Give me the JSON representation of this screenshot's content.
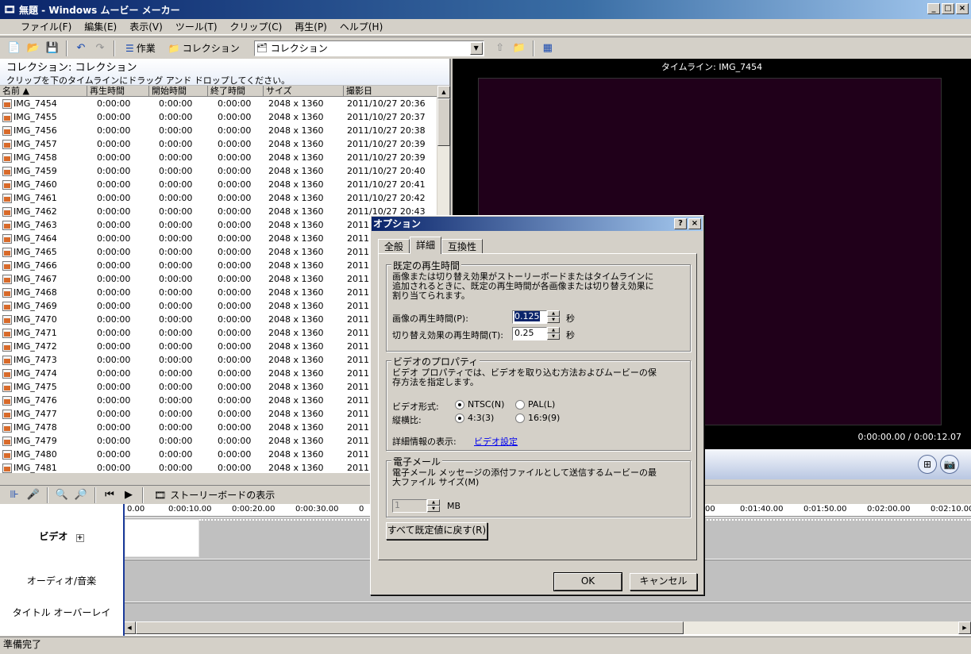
{
  "window": {
    "title": "無題 - Windows ムービー メーカー"
  },
  "menu": [
    "ファイル(F)",
    "編集(E)",
    "表示(V)",
    "ツール(T)",
    "クリップ(C)",
    "再生(P)",
    "ヘルプ(H)"
  ],
  "toolbar": {
    "tasks_label": "作業",
    "collections_label": "コレクション",
    "collection_combo": "コレクション"
  },
  "collection": {
    "title": "コレクション: コレクション",
    "instruction": "クリップを下のタイムラインにドラッグ アンド ドロップしてください。",
    "columns": [
      "名前",
      "再生時間",
      "開始時間",
      "終了時間",
      "サイズ",
      "撮影日"
    ],
    "rows": [
      [
        "IMG_7454",
        "0:00:00",
        "0:00:00",
        "0:00:00",
        "2048 x 1360",
        "2011/10/27 20:36"
      ],
      [
        "IMG_7455",
        "0:00:00",
        "0:00:00",
        "0:00:00",
        "2048 x 1360",
        "2011/10/27 20:37"
      ],
      [
        "IMG_7456",
        "0:00:00",
        "0:00:00",
        "0:00:00",
        "2048 x 1360",
        "2011/10/27 20:38"
      ],
      [
        "IMG_7457",
        "0:00:00",
        "0:00:00",
        "0:00:00",
        "2048 x 1360",
        "2011/10/27 20:39"
      ],
      [
        "IMG_7458",
        "0:00:00",
        "0:00:00",
        "0:00:00",
        "2048 x 1360",
        "2011/10/27 20:39"
      ],
      [
        "IMG_7459",
        "0:00:00",
        "0:00:00",
        "0:00:00",
        "2048 x 1360",
        "2011/10/27 20:40"
      ],
      [
        "IMG_7460",
        "0:00:00",
        "0:00:00",
        "0:00:00",
        "2048 x 1360",
        "2011/10/27 20:41"
      ],
      [
        "IMG_7461",
        "0:00:00",
        "0:00:00",
        "0:00:00",
        "2048 x 1360",
        "2011/10/27 20:42"
      ],
      [
        "IMG_7462",
        "0:00:00",
        "0:00:00",
        "0:00:00",
        "2048 x 1360",
        "2011/10/27 20:43"
      ],
      [
        "IMG_7463",
        "0:00:00",
        "0:00:00",
        "0:00:00",
        "2048 x 1360",
        "2011"
      ],
      [
        "IMG_7464",
        "0:00:00",
        "0:00:00",
        "0:00:00",
        "2048 x 1360",
        "2011"
      ],
      [
        "IMG_7465",
        "0:00:00",
        "0:00:00",
        "0:00:00",
        "2048 x 1360",
        "2011"
      ],
      [
        "IMG_7466",
        "0:00:00",
        "0:00:00",
        "0:00:00",
        "2048 x 1360",
        "2011"
      ],
      [
        "IMG_7467",
        "0:00:00",
        "0:00:00",
        "0:00:00",
        "2048 x 1360",
        "2011"
      ],
      [
        "IMG_7468",
        "0:00:00",
        "0:00:00",
        "0:00:00",
        "2048 x 1360",
        "2011"
      ],
      [
        "IMG_7469",
        "0:00:00",
        "0:00:00",
        "0:00:00",
        "2048 x 1360",
        "2011"
      ],
      [
        "IMG_7470",
        "0:00:00",
        "0:00:00",
        "0:00:00",
        "2048 x 1360",
        "2011"
      ],
      [
        "IMG_7471",
        "0:00:00",
        "0:00:00",
        "0:00:00",
        "2048 x 1360",
        "2011"
      ],
      [
        "IMG_7472",
        "0:00:00",
        "0:00:00",
        "0:00:00",
        "2048 x 1360",
        "2011"
      ],
      [
        "IMG_7473",
        "0:00:00",
        "0:00:00",
        "0:00:00",
        "2048 x 1360",
        "2011"
      ],
      [
        "IMG_7474",
        "0:00:00",
        "0:00:00",
        "0:00:00",
        "2048 x 1360",
        "2011"
      ],
      [
        "IMG_7475",
        "0:00:00",
        "0:00:00",
        "0:00:00",
        "2048 x 1360",
        "2011"
      ],
      [
        "IMG_7476",
        "0:00:00",
        "0:00:00",
        "0:00:00",
        "2048 x 1360",
        "2011"
      ],
      [
        "IMG_7477",
        "0:00:00",
        "0:00:00",
        "0:00:00",
        "2048 x 1360",
        "2011"
      ],
      [
        "IMG_7478",
        "0:00:00",
        "0:00:00",
        "0:00:00",
        "2048 x 1360",
        "2011"
      ],
      [
        "IMG_7479",
        "0:00:00",
        "0:00:00",
        "0:00:00",
        "2048 x 1360",
        "2011"
      ],
      [
        "IMG_7480",
        "0:00:00",
        "0:00:00",
        "0:00:00",
        "2048 x 1360",
        "2011"
      ],
      [
        "IMG_7481",
        "0:00:00",
        "0:00:00",
        "0:00:00",
        "2048 x 1360",
        "2011"
      ]
    ]
  },
  "preview": {
    "title": "タイムライン: IMG_7454",
    "time": "0:00:00.00 / 0:00:12.07"
  },
  "timeline": {
    "storyboard_label": "ストーリーボードの表示",
    "ruler": [
      "0.00",
      "0:00:10.00",
      "0:00:20.00",
      "0:00:30.00",
      "0",
      "00",
      "0:01:40.00",
      "0:01:50.00",
      "0:02:00.00",
      "0:02:10.00"
    ],
    "tracks": {
      "video": "ビデオ",
      "audio": "オーディオ/音楽",
      "title_overlay": "タイトル オーバーレイ"
    }
  },
  "status": "準備完了",
  "dialog": {
    "title": "オプション",
    "tabs": [
      "全般",
      "詳細",
      "互換性"
    ],
    "default_duration": {
      "legend": "既定の再生時間",
      "desc": "画像または切り替え効果がストーリーボードまたはタイムラインに追加されるときに、既定の再生時間が各画像または切り替え効果に割り当てられます。",
      "image_label": "画像の再生時間(P):",
      "image_value": "0.125",
      "transition_label": "切り替え効果の再生時間(T):",
      "transition_value": "0.25",
      "unit": "秒"
    },
    "video_properties": {
      "legend": "ビデオのプロパティ",
      "desc": "ビデオ プロパティでは、ビデオを取り込む方法およびムービーの保存方法を指定します。",
      "format_label": "ビデオ形式:",
      "ntsc": "NTSC(N)",
      "pal": "PAL(L)",
      "aspect_label": "縦横比:",
      "ratio_43": "4:3(3)",
      "ratio_169": "16:9(9)",
      "details_label": "詳細情報の表示:",
      "details_link": "ビデオ設定"
    },
    "email": {
      "legend": "電子メール",
      "desc": "電子メール メッセージの添付ファイルとして送信するムービーの最大ファイル サイズ(M)",
      "value": "1",
      "unit": "MB"
    },
    "reset_button": "すべて既定値に戻す(R)",
    "ok": "OK",
    "cancel": "キャンセル"
  }
}
